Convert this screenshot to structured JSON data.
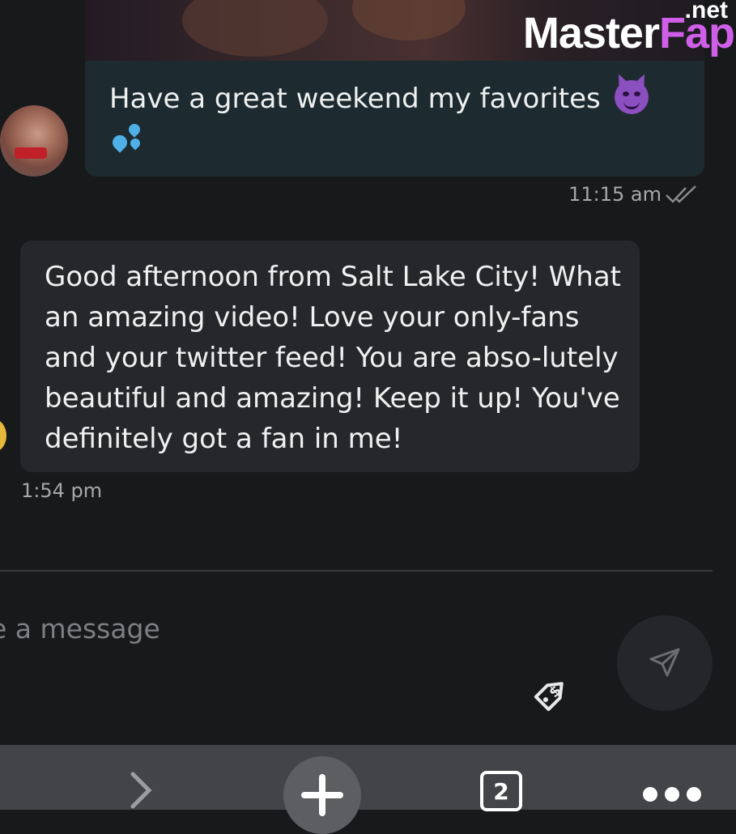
{
  "watermark": {
    "brand_main": "Master",
    "brand_accent": "Fap",
    "brand_tld": ".net"
  },
  "messages": [
    {
      "direction": "sent",
      "text": "Have a great weekend my favorites",
      "emojis": [
        "smiling-imp",
        "sweat-droplets"
      ],
      "time": "11:15 am",
      "status": "read"
    },
    {
      "direction": "received",
      "text": "Good afternoon from Salt Lake City! What an amazing video! Love your only-fans and your twitter feed! You are abso-lutely beautiful and amazing! Keep it up! You've definitely got a fan in me!",
      "time": "1:54 pm"
    }
  ],
  "composer": {
    "placeholder": "Type a message",
    "visible_placeholder": "e a message",
    "tag_icon": "price-tag-dollar-icon",
    "send_icon": "send-icon"
  },
  "bottom_nav": {
    "forward_icon": "chevron-right-icon",
    "add_icon": "plus-icon",
    "tab_count": "2",
    "more_icon": "more-icon"
  },
  "colors": {
    "background": "#18191b",
    "sent_bubble": "#1d2a2f",
    "received_bubble": "#26272a",
    "brand_accent": "#d05fe8"
  }
}
